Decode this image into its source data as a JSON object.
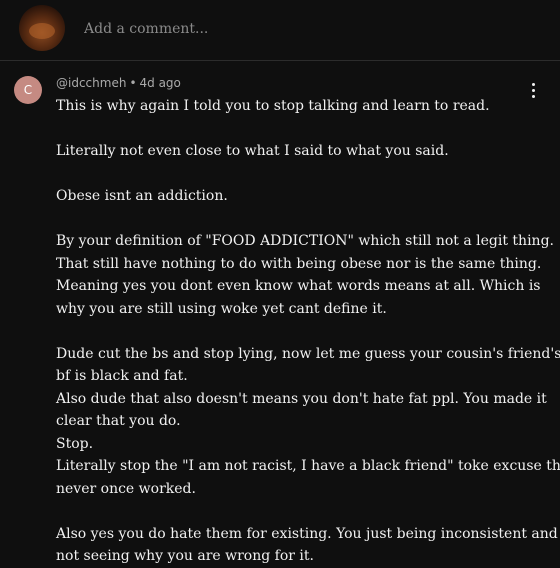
{
  "composer": {
    "placeholder": "Add a comment..."
  },
  "comment": {
    "avatar_letter": "C",
    "author": "@idcchmeh",
    "separator": "•",
    "time": "4d ago",
    "lines": [
      "This is why again I told you to stop talking and learn to read.",
      "",
      "Literally not even close to what I said to what you said.",
      "",
      "Obese isnt an addiction.",
      "",
      "By your definition of \"FOOD ADDICTION\" which still not a legit thing.",
      "That still have nothing to do with being obese nor is the same thing.",
      "Meaning yes you dont even know what words means at all. Which is",
      "why you are still using woke yet cant define it.",
      "",
      "Dude cut the bs and stop lying, now let me guess your cousin's friend's",
      "bf is black and fat.",
      "Also dude that also doesn't means you don't hate fat ppl. You made it",
      "clear that you do.",
      "Stop.",
      "Literally stop the \"I am not racist, I have a black friend\" toke excuse that",
      "never once worked.",
      "",
      "Also yes you do hate them for existing. You just being inconsistent and",
      "not seeing why you are wrong for it."
    ]
  },
  "colors": {
    "background": "#0f0f0f",
    "text": "#f1f1f1",
    "muted": "#aaaaaa",
    "avatar": "#c58a82"
  }
}
